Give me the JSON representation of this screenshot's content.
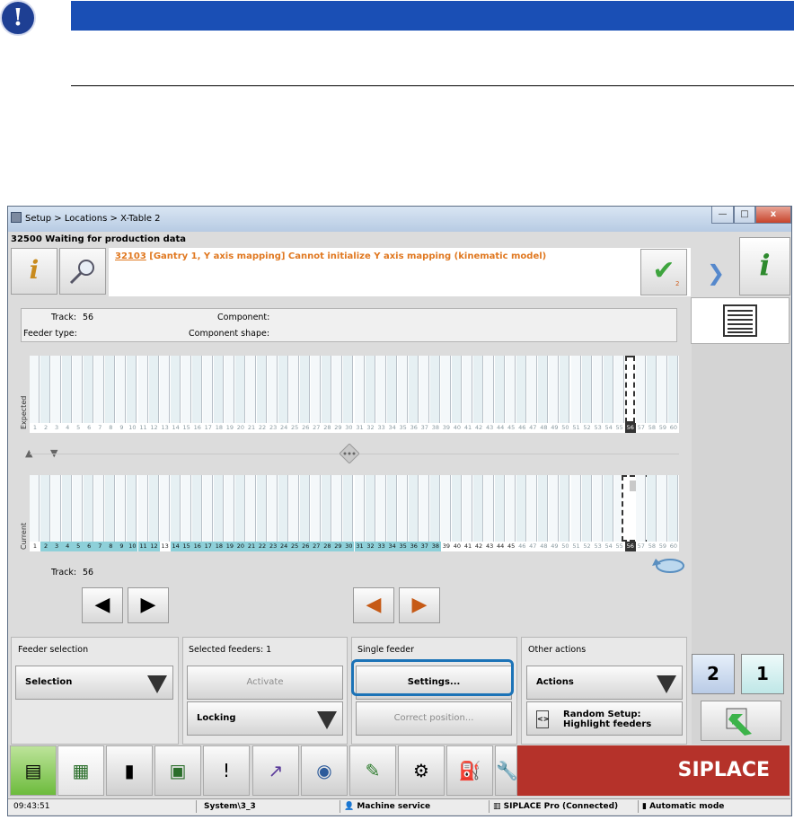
{
  "window": {
    "title": "Setup > Locations > X-Table 2",
    "minimize": "—",
    "maximize": "□",
    "close": "x"
  },
  "status_message": "32500 Waiting for production data",
  "message": {
    "code": "32103",
    "text": " [Gantry 1, Y axis mapping] Cannot initialize Y axis mapping (kinematic model)",
    "check_count": "2"
  },
  "info_panel": {
    "track_label": "Track:",
    "track_value": "56",
    "component_label": "Component:",
    "feeder_type_label": "Feeder type:",
    "component_shape_label": "Component shape:"
  },
  "slots": {
    "expected_label": "Expected",
    "current_label": "Current",
    "numbers": [
      "1",
      "2",
      "3",
      "4",
      "5",
      "6",
      "7",
      "8",
      "9",
      "10",
      "11",
      "12",
      "13",
      "14",
      "15",
      "16",
      "17",
      "18",
      "19",
      "20",
      "21",
      "22",
      "23",
      "24",
      "25",
      "26",
      "27",
      "28",
      "29",
      "30",
      "31",
      "32",
      "33",
      "34",
      "35",
      "36",
      "37",
      "38",
      "39",
      "40",
      "41",
      "42",
      "43",
      "44",
      "45",
      "46",
      "47",
      "48",
      "49",
      "50",
      "51",
      "52",
      "53",
      "54",
      "55",
      "56",
      "57",
      "58",
      "59",
      "60"
    ],
    "current_highlight": [
      2,
      3,
      4,
      5,
      6,
      7,
      8,
      9,
      10,
      11,
      12,
      14,
      15,
      16,
      17,
      18,
      19,
      20,
      21,
      22,
      23,
      24,
      25,
      26,
      27,
      28,
      29,
      30,
      31,
      32,
      33,
      34,
      35,
      36,
      37,
      38
    ],
    "selected_slot": "56"
  },
  "track_footer": {
    "label": "Track:",
    "value": "56"
  },
  "groups": {
    "feeder_selection": {
      "title": "Feeder selection",
      "button": "Selection"
    },
    "selected_feeders": {
      "title": "Selected feeders: 1",
      "activate": "Activate",
      "locking": "Locking"
    },
    "single_feeder": {
      "title": "Single feeder",
      "settings": "Settings...",
      "correct": "Correct position..."
    },
    "other_actions": {
      "title": "Other actions",
      "actions": "Actions",
      "random_setup": "Random Setup:",
      "highlight": "Highlight feeders"
    }
  },
  "side_buttons": {
    "two": "2",
    "one": "1"
  },
  "taskbar": {
    "brand": "SIPLACE"
  },
  "statusbar": {
    "time": "09:43:51",
    "system": "System\\3_3",
    "user": "Machine service",
    "connection": "SIPLACE Pro (Connected)",
    "mode": "Automatic mode"
  },
  "icons": [
    "warning-icon",
    "info-icon",
    "search-icon",
    "check-icon",
    "list-icon",
    "left-arrow-icon",
    "right-arrow-icon",
    "rotate-icon",
    "exit-icon"
  ],
  "colors": {
    "accent": "#1a4fb5",
    "brand": "#b5322a",
    "focus": "#1c73b7",
    "slot_highlight": "#8ed0d9",
    "warning_text": "#e07820"
  }
}
